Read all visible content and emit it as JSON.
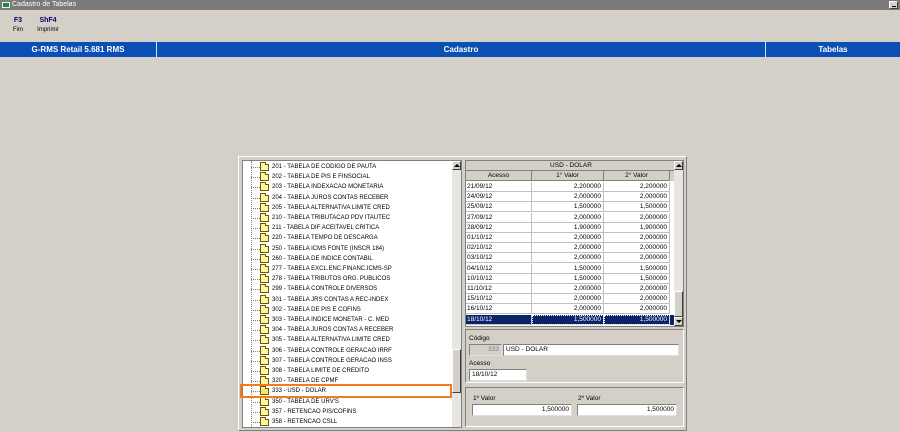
{
  "window": {
    "title": "Cadastro de Tabelas"
  },
  "toolbar": [
    {
      "key": "F3",
      "label": "Fim"
    },
    {
      "key": "ShF4",
      "label": "Imprimir"
    }
  ],
  "header": {
    "system": "G-RMS Retail 5.681 RMS",
    "module": "Cadastro",
    "screen": "Tabelas"
  },
  "tree": {
    "items": [
      "201 - TABELA DE CODIGO DE PAUTA",
      "202 - TABELA DE PIS E FINSOCIAL",
      "203 - TABELA INDEXACAO MONETARIA",
      "204 - TABELA JUROS CONTAS RECEBER",
      "205 - TABELA ALTERNATIVA LIMITE CRED",
      "210 - TABELA TRIBUTACAO PDV ITAUTEC",
      "211 - TABELA DIF ACEITAVEL  CRITICA",
      "220 - TABELA TEMPO DE DESCARGA",
      "250 - TABELA ICMS FONTE (INSCR 184)",
      "260 - TABELA DE INDICE CONTABIL",
      "277 - TABELA EXCL.ENC.FINANC.ICMS-SP",
      "278 - TABELA TRIBUTOS ORG. PUBLICOS",
      "299 - TABELA CONTROLE DIVERSOS",
      "301 - TABELA JRS CONTAS A REC-INDEX",
      "302 - TABELA DE PIS E COFINS",
      "303 - TABELA INDICE MONETAR - C. MED",
      "304 - TABELA JUROS CONTAS A RECEBER",
      "305 - TABELA ALTERNATIVA LIMITE CRED",
      "306 - TABELA CONTROLE GERACAO IRRF",
      "307 - TABELA CONTROLE  GERACAO INSS",
      "308 - TABELA LIMITE DE CREDITO",
      "320 - TABELA DE CPMF",
      "333 - USD - DOLAR",
      "350 - TABELA DE URV'S",
      "357 - RETENCAO PIS/COFINS",
      "358 - RETENCAO CSLL"
    ],
    "selected_index": 22
  },
  "grid": {
    "title": "USD - DOLAR",
    "columns": [
      "Acesso",
      "1° Valor",
      "2° Valor"
    ],
    "rows": [
      [
        "21/09/12",
        "2,200000",
        "2,200000"
      ],
      [
        "24/09/12",
        "2,000000",
        "2,000000"
      ],
      [
        "25/09/12",
        "1,500000",
        "1,500000"
      ],
      [
        "27/09/12",
        "2,000000",
        "2,000000"
      ],
      [
        "28/09/12",
        "1,900000",
        "1,900000"
      ],
      [
        "01/10/12",
        "2,000000",
        "2,000000"
      ],
      [
        "02/10/12",
        "2,000000",
        "2,000000"
      ],
      [
        "03/10/12",
        "2,000000",
        "2,000000"
      ],
      [
        "04/10/12",
        "1,500000",
        "1,500000"
      ],
      [
        "10/10/12",
        "1,500000",
        "1,500000"
      ],
      [
        "11/10/12",
        "2,000000",
        "2,000000"
      ],
      [
        "15/10/12",
        "2,000000",
        "2,000000"
      ],
      [
        "16/10/12",
        "2,000000",
        "2,000000"
      ],
      [
        "18/10/12",
        "1,500000",
        "1,500000"
      ]
    ],
    "selected_index": 13
  },
  "detail": {
    "codigo_label": "Código",
    "codigo_value": "333",
    "codigo_desc": "USD - DOLAR",
    "acesso_label": "Acesso",
    "acesso_value": "18/10/12",
    "valor1_label": "1º Valor",
    "valor1_value": "1,500000",
    "valor2_label": "2º Valor",
    "valor2_value": "1,500000"
  }
}
